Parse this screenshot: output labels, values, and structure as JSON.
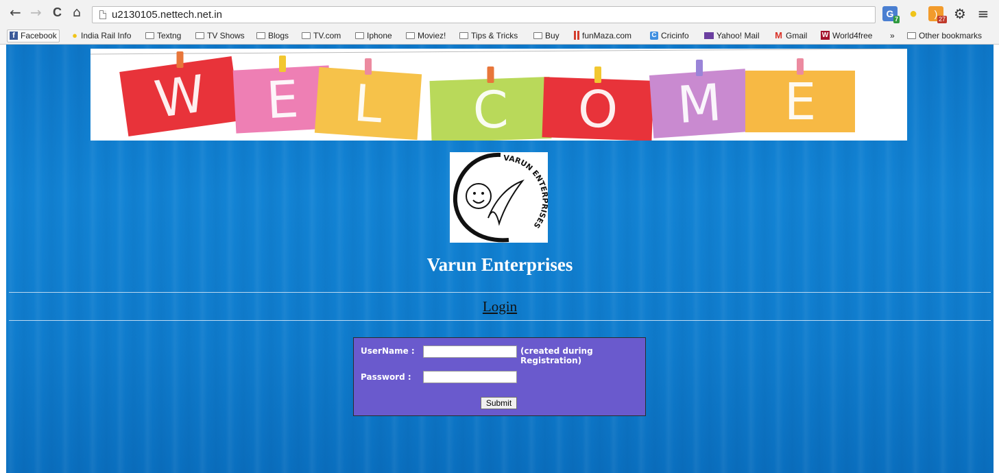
{
  "browser": {
    "url": "u2130105.nettech.net.in",
    "nav": {
      "back": "←",
      "forward": "→",
      "reload": "C",
      "home": "⌂"
    },
    "extensions": {
      "g_badge": "7",
      "rss_badge": "27",
      "gear": "⚙",
      "menu": "≡"
    },
    "bookmarks": [
      {
        "label": "Facebook",
        "icon": "facebook-icon"
      },
      {
        "label": "India Rail Info",
        "icon": "bulb-icon"
      },
      {
        "label": "Textng",
        "icon": "folder-icon"
      },
      {
        "label": "TV Shows",
        "icon": "folder-icon"
      },
      {
        "label": "Blogs",
        "icon": "folder-icon"
      },
      {
        "label": "TV.com",
        "icon": "folder-icon"
      },
      {
        "label": "Iphone",
        "icon": "folder-icon"
      },
      {
        "label": "Moviez!",
        "icon": "folder-icon"
      },
      {
        "label": "Tips & Tricks",
        "icon": "folder-icon"
      },
      {
        "label": "Buy",
        "icon": "folder-icon"
      },
      {
        "label": "funMaza.com",
        "icon": "funmaza-icon"
      },
      {
        "label": "Cricinfo",
        "icon": "cricinfo-icon"
      },
      {
        "label": "Yahoo! Mail",
        "icon": "yahoo-mail-icon"
      },
      {
        "label": "Gmail",
        "icon": "gmail-icon"
      },
      {
        "label": "World4free",
        "icon": "world4free-icon"
      },
      {
        "label": "»",
        "icon": ""
      },
      {
        "label": "Other bookmarks",
        "icon": "folder-icon"
      }
    ]
  },
  "page": {
    "banner_letters": [
      "W",
      "E",
      "L",
      "C",
      "O",
      "M",
      "E"
    ],
    "banner_colors": [
      "#e8333a",
      "#ee7fb4",
      "#f6c24a",
      "#b9d95a",
      "#e8333a",
      "#c98ad0",
      "#f7b944"
    ],
    "logo_text": "VARUN ENTERPRISES",
    "company_name": "Varun Enterprises",
    "login_link": "Login",
    "form": {
      "username_label": "UserName :",
      "username_hint": "(created during Registration)",
      "password_label": "Password :",
      "submit_label": "Submit",
      "username_value": "",
      "password_value": ""
    }
  }
}
